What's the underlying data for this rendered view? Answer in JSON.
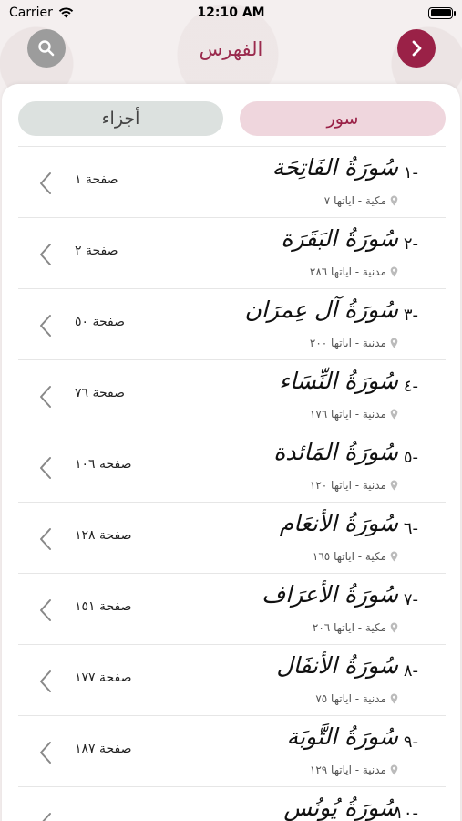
{
  "status_bar": {
    "carrier": "Carrier",
    "time": "12:10 AM"
  },
  "nav": {
    "title": "الفهرس"
  },
  "tabs": {
    "juz_label": "أجزاء",
    "sura_label": "سور"
  },
  "suras": [
    {
      "num": "-١",
      "name": "سُورَةُ الفَاتِحَة",
      "info": "مكية - اياتها ٧",
      "page": "صفحة ١"
    },
    {
      "num": "-٢",
      "name": "سُورَةُ البَقَرَة",
      "info": "مدنية - اياتها ٢٨٦",
      "page": "صفحة ٢"
    },
    {
      "num": "-٣",
      "name": "سُورَةُ آل عِمرَان",
      "info": "مدنية - اياتها ٢٠٠",
      "page": "صفحة ٥٠"
    },
    {
      "num": "-٤",
      "name": "سُورَةُ النِّسَاء",
      "info": "مدنية - اياتها ١٧٦",
      "page": "صفحة ٧٦"
    },
    {
      "num": "-٥",
      "name": "سُورَةُ المَائدة",
      "info": "مدنية - اياتها ١٢٠",
      "page": "صفحة ١٠٦"
    },
    {
      "num": "-٦",
      "name": "سُورَةُ الأنعَام",
      "info": "مكية - اياتها ١٦٥",
      "page": "صفحة ١٢٨"
    },
    {
      "num": "-٧",
      "name": "سُورَةُ الأعرَاف",
      "info": "مكية - اياتها ٢٠٦",
      "page": "صفحة ١٥١"
    },
    {
      "num": "-٨",
      "name": "سُورَةُ الأنفَال",
      "info": "مدنية - اياتها ٧٥",
      "page": "صفحة ١٧٧"
    },
    {
      "num": "-٩",
      "name": "سُورَةُ التَّوبَة",
      "info": "مدنية - اياتها ١٢٩",
      "page": "صفحة ١٨٧"
    },
    {
      "num": "-١٠",
      "name": "سُورَةُ يُونُس",
      "info": "",
      "page": ""
    }
  ]
}
